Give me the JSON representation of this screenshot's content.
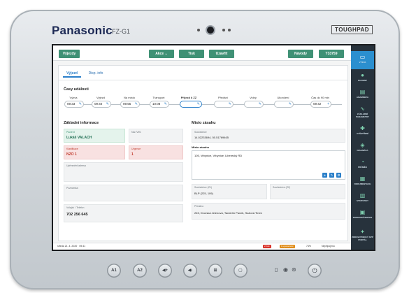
{
  "device": {
    "brand": "Panasonic",
    "model": "FZ-G1",
    "badge": "TOUGHPAD"
  },
  "topbar": {
    "vyjezdy": "Výjezdy",
    "akce": "Akce ⌄",
    "tisk": "Tisk",
    "uzavrit": "Uzavřít",
    "navody": "Návody",
    "code": "T33759"
  },
  "tabs": [
    {
      "label": "Výjezd"
    },
    {
      "label": "Disp. info"
    }
  ],
  "timeline": {
    "title": "Časy události",
    "columns": [
      {
        "label": "Výzva",
        "value": "09:33"
      },
      {
        "label": "Výjezd",
        "value": "09:40"
      },
      {
        "label": "Na místo",
        "value": "09:55"
      },
      {
        "label": "Transport",
        "value": "10:08"
      },
      {
        "label": "Příjezd k ZZ",
        "value": ""
      },
      {
        "label": "Předání",
        "value": ""
      },
      {
        "label": "Volný",
        "value": ""
      },
      {
        "label": "Ukončení",
        "value": ""
      },
      {
        "label": "Čas do 90 min",
        "value": "09:42"
      }
    ]
  },
  "basic": {
    "title": "Základní informace",
    "pacient_label": "Pacient",
    "pacient_value": "Lukáš VALACH",
    "narozeni_label": "Nar./Věk",
    "narozeni_value": "",
    "klasifikace_label": "Klasifikace",
    "klasifikace_value": "NZO 1",
    "urgence_label": "Urgence",
    "urgence_value": "1",
    "upresneni_label": "Upřesnění/adresa",
    "upresneni_value": "",
    "poznamka_label": "Poznámka",
    "poznamka_value": "",
    "telefon_label": "Volající / Telefon",
    "telefon_value": "702 256 645"
  },
  "place": {
    "title": "Místo zásahu",
    "souradnice_label": "Souřadnice",
    "souradnice_value": "14.02233694, 50.51769465",
    "misto_label": "Místo zásahu",
    "misto_value": "105, Vrbynice, Vrbynice, Liberecký RD",
    "z1_label": "Souřadnice (Z1)",
    "z1_value": "BLP (225, 109)",
    "z2_label": "Souřadnice (Z2)",
    "z2_value": "",
    "predat_label": "Předáno",
    "predat_value": "245, Dvorská Jelenová, Tandelín Panek, Sažová Tinek"
  },
  "statusbar": {
    "datetime": "středa 21. 4. 2020 · 09:41",
    "badge1": "2 Fult",
    "badge2": "1 upozornění",
    "battery": "74%",
    "network": "Nepřipojeno"
  },
  "sidebar": {
    "items": [
      {
        "label": "VÝZVA",
        "icon": "folder-icon"
      },
      {
        "label": "PACIENT",
        "icon": "person-icon"
      },
      {
        "label": "ANAMNÉZA",
        "icon": "clipboard-icon"
      },
      {
        "label": "ZÁKLADNÍ PARAMETRY",
        "icon": "vitals-icon"
      },
      {
        "label": "VYŠETŘENÍ",
        "icon": "stethoscope-icon"
      },
      {
        "label": "DIAGNÓZA",
        "icon": "diagnosis-icon"
      },
      {
        "label": "PRŮBĚH",
        "icon": "timeline-icon"
      },
      {
        "label": "DOKUMENTACE",
        "icon": "doc-icon"
      },
      {
        "label": "STATISTIKY",
        "icon": "chart-icon"
      },
      {
        "label": "DOPRAVNÍ SERVIS",
        "icon": "car-icon"
      },
      {
        "label": "ZDRAVOTNICKÝ APP PORTÁL",
        "icon": "portal-icon"
      }
    ]
  },
  "hardware": {
    "a1": "A1",
    "a2": "A2"
  },
  "colors": {
    "accent_green": "#3f9175",
    "accent_blue": "#2a7fc9",
    "sidebar_bg": "#27323c"
  }
}
